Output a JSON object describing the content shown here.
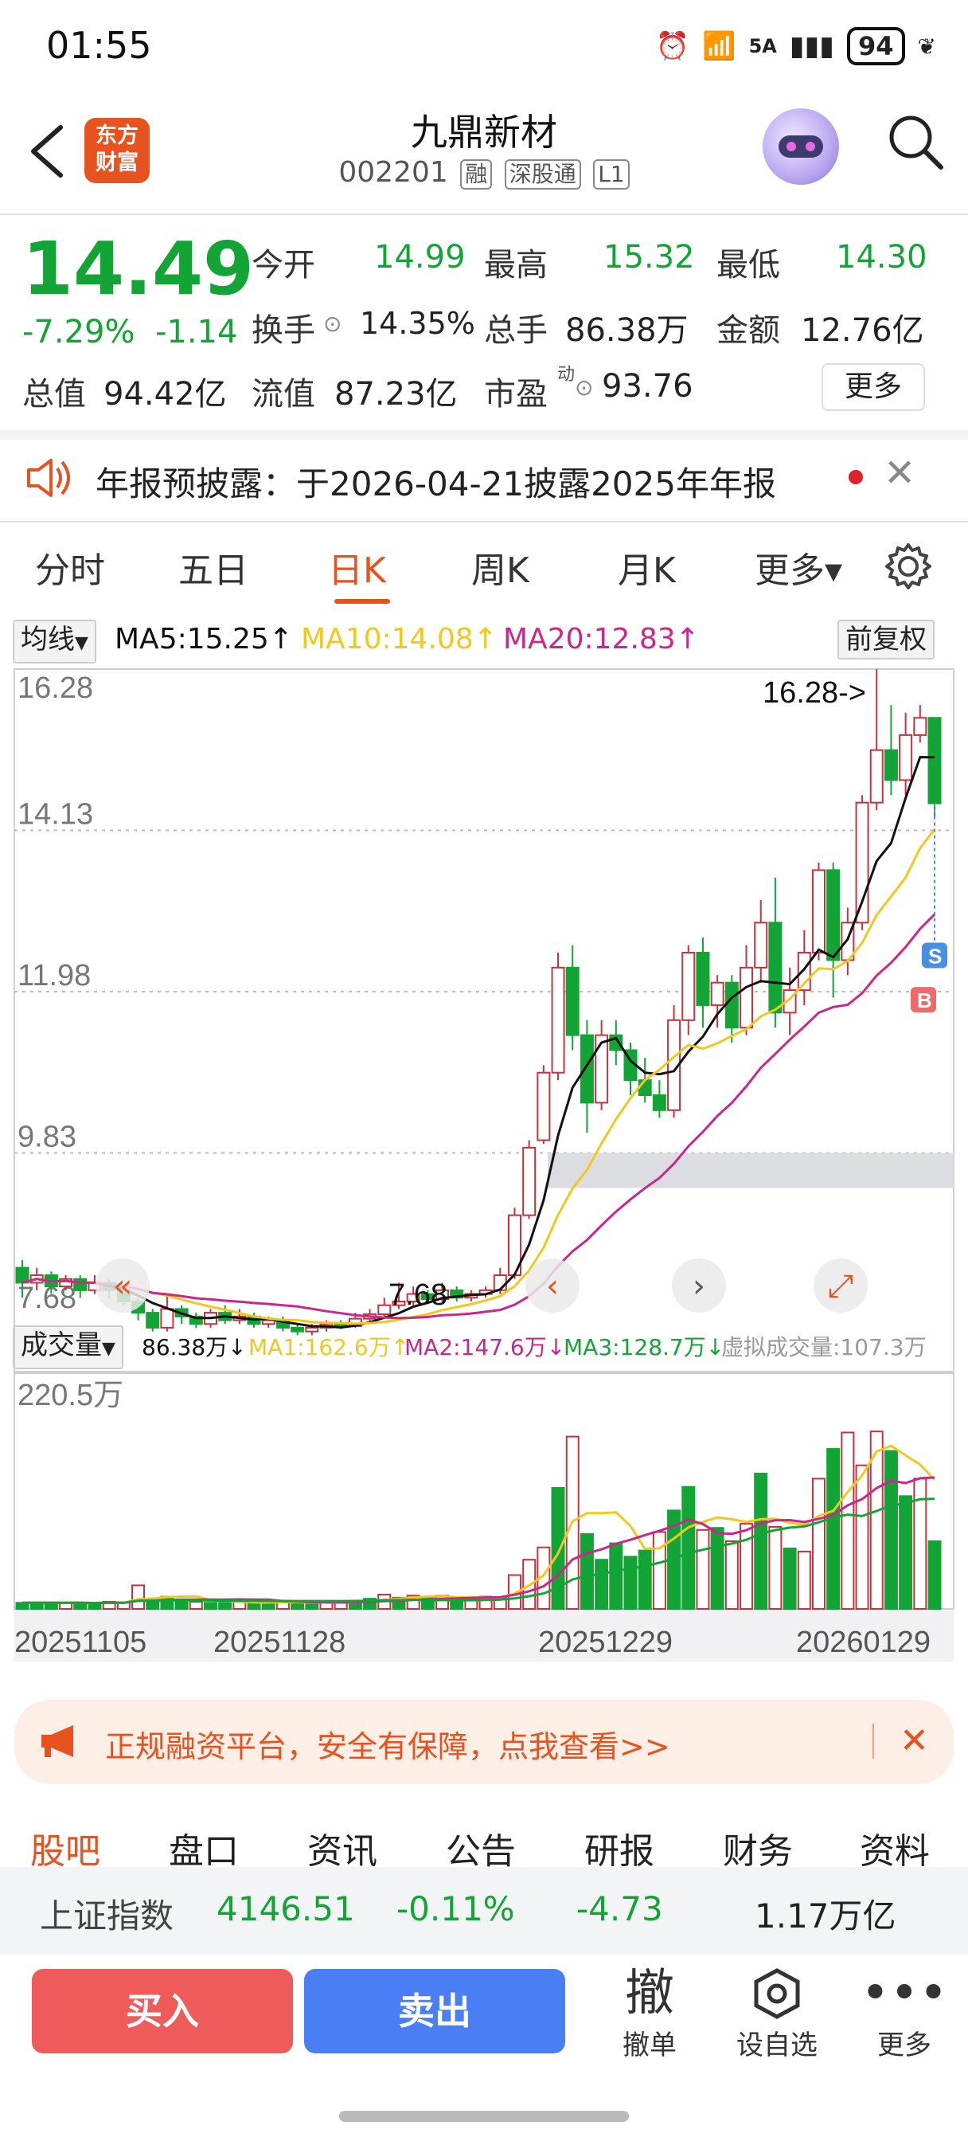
{
  "status": {
    "time": "01:55",
    "signal_label": "5A",
    "battery": "94"
  },
  "header": {
    "stock_name": "九鼎新材",
    "stock_code": "002201",
    "tags": [
      "融",
      "深股通",
      "L1"
    ],
    "logo_text_line1": "东方",
    "logo_text_line2": "财富"
  },
  "quote": {
    "price": "14.49",
    "change_pct": "-7.29%",
    "change_amt": "-1.14",
    "open_label": "今开",
    "open": "14.99",
    "high_label": "最高",
    "high": "15.32",
    "low_label": "最低",
    "low": "14.30",
    "turnover_label": "换手",
    "turnover": "14.35%",
    "volume_label": "总手",
    "volume": "86.38万",
    "amount_label": "金额",
    "amount": "12.76亿",
    "mktcap_label": "总值",
    "mktcap": "94.42亿",
    "float_label": "流值",
    "float": "87.23亿",
    "pe_label": "市盈",
    "pe_sup": "动",
    "pe": "93.76",
    "more_label": "更多"
  },
  "notice": {
    "text": "年报预披露：于2026-04-21披露2025年年报"
  },
  "tabs": [
    {
      "label": "分时"
    },
    {
      "label": "五日"
    },
    {
      "label": "日K"
    },
    {
      "label": "周K"
    },
    {
      "label": "月K"
    },
    {
      "label": "更多▾"
    }
  ],
  "ma_legend": {
    "selector": "均线",
    "ma5": "MA5:15.25↑",
    "ma10": "MA10:14.08↑",
    "ma20": "MA20:12.83↑",
    "adjust": "前复权"
  },
  "vol_legend": {
    "selector": "成交量",
    "vol": "86.38万↓",
    "ma1": "MA1:162.6万↑",
    "ma2": "MA2:147.6万↓",
    "ma3": "MA3:128.7万↓",
    "virtual": "虚拟成交量:107.3万"
  },
  "colors": {
    "up": "#c8323c",
    "down": "#12a536",
    "ma5": "#111111",
    "ma10": "#f2c81e",
    "ma20": "#c8288c",
    "accent": "#e8521e"
  },
  "chart_data": {
    "type": "candlestick",
    "y_labels": [
      "16.28",
      "14.13",
      "11.98",
      "9.83",
      "7.68"
    ],
    "ylim": [
      7.68,
      16.28
    ],
    "max_annotation": "16.28->",
    "min_annotation": "7.68",
    "x_labels": [
      "20251105",
      "20251128",
      "20251229",
      "20260129"
    ],
    "vol_label_max": "220.5万",
    "markers": [
      "S",
      "B"
    ],
    "candles": [
      [
        8.3,
        8.1,
        8.4,
        7.9
      ],
      [
        8.1,
        8.2,
        8.3,
        8.0
      ],
      [
        8.2,
        8.05,
        8.25,
        7.95
      ],
      [
        8.05,
        8.15,
        8.2,
        8.0
      ],
      [
        8.15,
        8.0,
        8.2,
        7.9
      ],
      [
        8.0,
        8.1,
        8.2,
        7.95
      ],
      [
        8.1,
        8.0,
        8.15,
        7.9
      ],
      [
        8.0,
        7.85,
        8.05,
        7.8
      ],
      [
        7.85,
        7.7,
        7.9,
        7.6
      ],
      [
        7.7,
        7.5,
        7.75,
        7.45
      ],
      [
        7.5,
        7.75,
        7.95,
        7.45
      ],
      [
        7.75,
        7.65,
        7.8,
        7.55
      ],
      [
        7.65,
        7.55,
        7.7,
        7.5
      ],
      [
        7.55,
        7.7,
        7.75,
        7.5
      ],
      [
        7.7,
        7.6,
        7.8,
        7.55
      ],
      [
        7.6,
        7.65,
        7.75,
        7.55
      ],
      [
        7.65,
        7.55,
        7.7,
        7.5
      ],
      [
        7.55,
        7.6,
        7.65,
        7.5
      ],
      [
        7.6,
        7.5,
        7.65,
        7.45
      ],
      [
        7.5,
        7.45,
        7.55,
        7.4
      ],
      [
        7.45,
        7.5,
        7.55,
        7.4
      ],
      [
        7.5,
        7.55,
        7.6,
        7.45
      ],
      [
        7.55,
        7.52,
        7.6,
        7.48
      ],
      [
        7.52,
        7.62,
        7.7,
        7.5
      ],
      [
        7.62,
        7.68,
        7.75,
        7.58
      ],
      [
        7.68,
        7.8,
        7.9,
        7.62
      ],
      [
        7.8,
        7.85,
        8.1,
        7.75
      ],
      [
        7.85,
        7.95,
        8.05,
        7.8
      ],
      [
        7.95,
        7.88,
        8.0,
        7.82
      ],
      [
        7.88,
        8.0,
        8.1,
        7.85
      ],
      [
        8.0,
        7.9,
        8.05,
        7.85
      ],
      [
        7.9,
        7.95,
        8.0,
        7.85
      ],
      [
        7.95,
        8.0,
        8.05,
        7.9
      ],
      [
        8.0,
        8.2,
        8.3,
        7.95
      ],
      [
        8.2,
        9.0,
        9.1,
        8.15
      ],
      [
        9.0,
        9.9,
        10.0,
        8.95
      ],
      [
        10.0,
        10.9,
        11.0,
        9.95
      ],
      [
        10.9,
        12.3,
        12.5,
        10.8
      ],
      [
        12.3,
        11.4,
        12.6,
        11.2
      ],
      [
        11.4,
        10.5,
        11.6,
        10.1
      ],
      [
        10.5,
        11.4,
        11.6,
        10.4
      ],
      [
        11.4,
        11.2,
        11.6,
        11.0
      ],
      [
        11.2,
        10.8,
        11.3,
        10.6
      ],
      [
        10.8,
        10.6,
        11.1,
        10.5
      ],
      [
        10.6,
        10.4,
        10.8,
        10.3
      ],
      [
        10.4,
        11.6,
        11.8,
        10.3
      ],
      [
        11.6,
        12.5,
        12.6,
        11.4
      ],
      [
        12.5,
        11.8,
        12.7,
        11.5
      ],
      [
        11.8,
        12.1,
        12.2,
        11.5
      ],
      [
        12.1,
        11.5,
        12.2,
        11.3
      ],
      [
        11.5,
        12.3,
        12.6,
        11.4
      ],
      [
        12.3,
        12.9,
        13.2,
        12.1
      ],
      [
        12.9,
        11.7,
        13.5,
        11.5
      ],
      [
        11.7,
        12.0,
        12.3,
        11.4
      ],
      [
        12.0,
        12.5,
        12.8,
        11.8
      ],
      [
        12.5,
        13.6,
        13.7,
        12.4
      ],
      [
        13.6,
        12.4,
        13.7,
        11.9
      ],
      [
        12.4,
        12.9,
        13.1,
        12.2
      ],
      [
        12.9,
        14.5,
        14.6,
        12.8
      ],
      [
        14.5,
        15.2,
        16.28,
        14.4
      ],
      [
        15.2,
        14.8,
        15.8,
        14.6
      ],
      [
        14.8,
        15.4,
        15.7,
        14.6
      ],
      [
        15.4,
        15.63,
        15.8,
        15.3
      ],
      [
        15.63,
        14.49,
        15.32,
        14.3
      ]
    ],
    "volumes": [
      [
        6,
        "d"
      ],
      [
        6,
        "d"
      ],
      [
        6,
        "d"
      ],
      [
        6,
        "u"
      ],
      [
        6,
        "d"
      ],
      [
        5,
        "d"
      ],
      [
        7,
        "u"
      ],
      [
        6,
        "u"
      ],
      [
        23,
        "u"
      ],
      [
        10,
        "d"
      ],
      [
        12,
        "d"
      ],
      [
        9,
        "d"
      ],
      [
        7,
        "u"
      ],
      [
        6,
        "d"
      ],
      [
        6,
        "d"
      ],
      [
        7,
        "u"
      ],
      [
        6,
        "d"
      ],
      [
        6,
        "d"
      ],
      [
        8,
        "u"
      ],
      [
        6,
        "d"
      ],
      [
        5,
        "d"
      ],
      [
        7,
        "u"
      ],
      [
        6,
        "u"
      ],
      [
        8,
        "d"
      ],
      [
        10,
        "d"
      ],
      [
        14,
        "u"
      ],
      [
        11,
        "d"
      ],
      [
        13,
        "u"
      ],
      [
        12,
        "d"
      ],
      [
        13,
        "u"
      ],
      [
        9,
        "d"
      ],
      [
        10,
        "u"
      ],
      [
        12,
        "u"
      ],
      [
        11,
        "u"
      ],
      [
        33,
        "u"
      ],
      [
        48,
        "u"
      ],
      [
        60,
        "u"
      ],
      [
        118,
        "d"
      ],
      [
        168,
        "u"
      ],
      [
        73,
        "d"
      ],
      [
        48,
        "d"
      ],
      [
        64,
        "d"
      ],
      [
        51,
        "d"
      ],
      [
        57,
        "d"
      ],
      [
        75,
        "u"
      ],
      [
        96,
        "d"
      ],
      [
        119,
        "d"
      ],
      [
        77,
        "u"
      ],
      [
        79,
        "d"
      ],
      [
        66,
        "u"
      ],
      [
        83,
        "u"
      ],
      [
        132,
        "d"
      ],
      [
        80,
        "u"
      ],
      [
        59,
        "d"
      ],
      [
        56,
        "u"
      ],
      [
        127,
        "u"
      ],
      [
        156,
        "d"
      ],
      [
        172,
        "u"
      ],
      [
        140,
        "u"
      ],
      [
        173,
        "u"
      ],
      [
        154,
        "d"
      ],
      [
        110,
        "d"
      ],
      [
        127,
        "u"
      ],
      [
        66,
        "d"
      ]
    ]
  },
  "ad": {
    "text": "正规融资平台，安全有保障，点我查看>>"
  },
  "subtabs": [
    {
      "label": "股吧"
    },
    {
      "label": "盘口"
    },
    {
      "label": "资讯"
    },
    {
      "label": "公告"
    },
    {
      "label": "研报"
    },
    {
      "label": "财务"
    },
    {
      "label": "资料"
    }
  ],
  "index": {
    "name": "上证指数",
    "value": "4146.51",
    "pct": "-0.11%",
    "chg": "-4.73",
    "amount": "1.17万亿"
  },
  "bottom": {
    "buy": "买入",
    "sell": "卖出",
    "cancel_icon": "撤",
    "cancel": "撤单",
    "watch": "设自选",
    "more": "更多"
  }
}
